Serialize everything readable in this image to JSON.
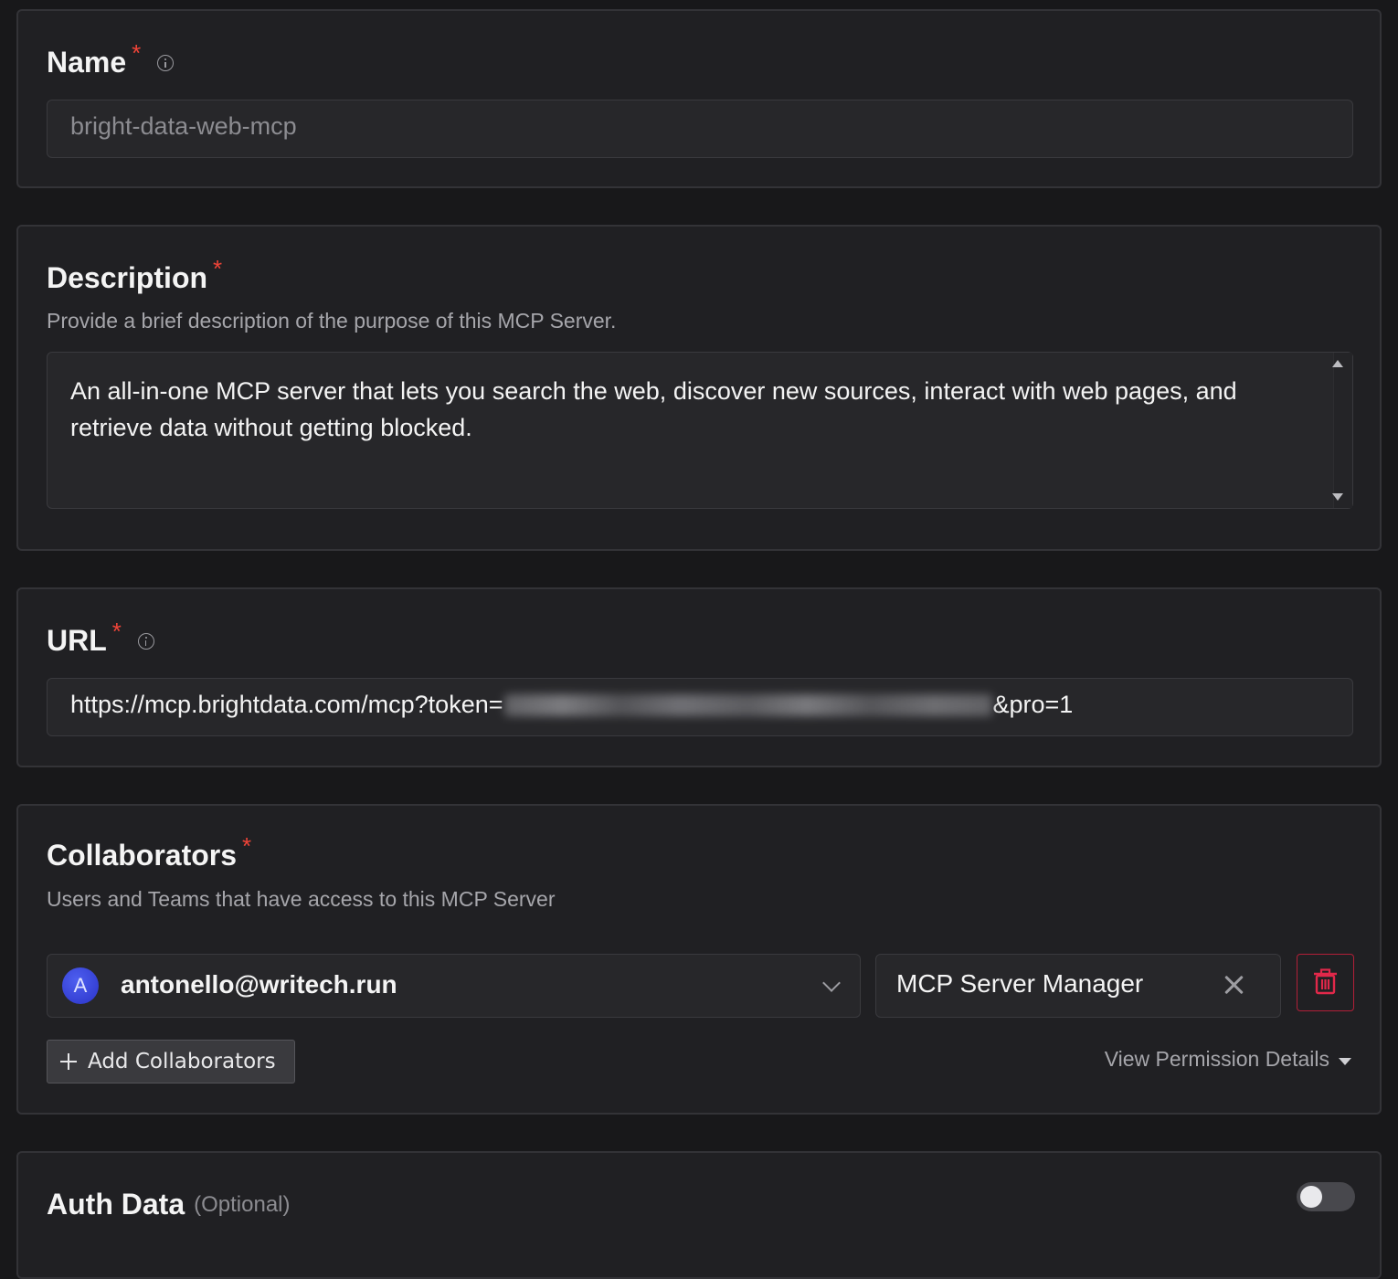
{
  "name_section": {
    "title": "Name",
    "required_mark": "*",
    "placeholder": "bright-data-web-mcp"
  },
  "description_section": {
    "title": "Description",
    "required_mark": "*",
    "subtitle": "Provide a brief description of the purpose of this MCP Server.",
    "value_line1": "An all-in-one MCP server that lets you search the web, discover new sources, interact with web pages, and",
    "value_line2": "retrieve data without getting blocked."
  },
  "url_section": {
    "title": "URL",
    "required_mark": "*",
    "value_prefix": "https://mcp.brightdata.com/mcp?token=",
    "value_suffix": "&pro=1"
  },
  "collaborators_section": {
    "title": "Collaborators",
    "required_mark": "*",
    "subtitle": "Users and Teams that have access to this MCP Server",
    "collaborator": {
      "avatar_initial": "A",
      "email": "antonello@writech.run",
      "role": "MCP Server Manager"
    },
    "add_button_label": "Add Collaborators",
    "view_permission_label": "View Permission Details"
  },
  "auth_section": {
    "title": "Auth Data",
    "optional_label": "(Optional)",
    "toggle_enabled": false
  },
  "icons": {
    "info": "info-icon",
    "chevron": "chevron-down-icon",
    "remove": "close-icon",
    "delete": "trash-icon",
    "add": "plus-icon",
    "caret": "caret-down-icon"
  },
  "colors": {
    "background": "#18181a",
    "card": "#202023",
    "required": "#f04438",
    "avatar": "#3b47e0",
    "danger": "#b11f38"
  }
}
